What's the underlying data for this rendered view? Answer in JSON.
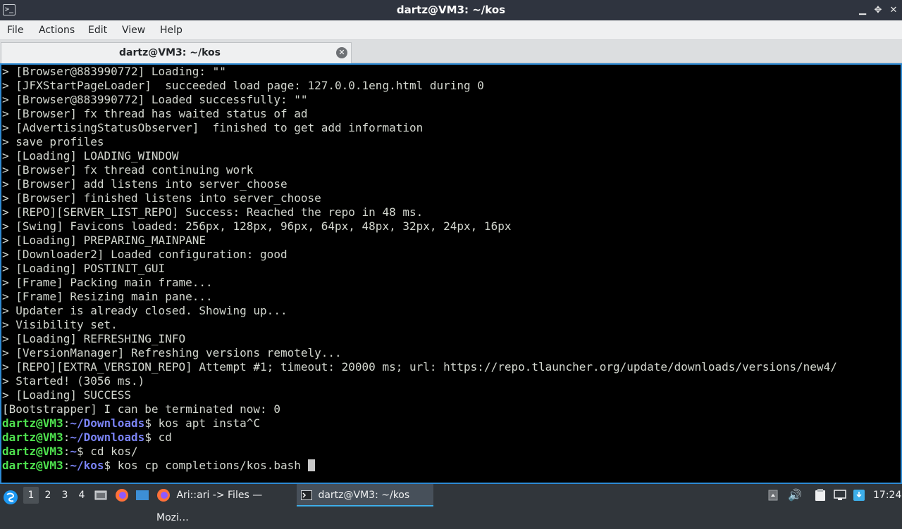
{
  "window": {
    "app_icon": ">_",
    "title": "dartz@VM3: ~/kos",
    "minimize": "▁",
    "maximize": "✥",
    "close": "✕"
  },
  "menu": [
    "File",
    "Actions",
    "Edit",
    "View",
    "Help"
  ],
  "tab": {
    "label": "dartz@VM3: ~/kos",
    "close": "✕"
  },
  "terminal": {
    "lines": [
      "> [Browser@883990772] Loading: \"\"",
      "> [JFXStartPageLoader]  succeeded load page: 127.0.0.1eng.html during 0",
      "> [Browser@883990772] Loaded successfully: \"\"",
      "> [Browser] fx thread has waited status of ad",
      "> [AdvertisingStatusObserver]  finished to get add information",
      "> save profiles",
      "> [Loading] LOADING_WINDOW",
      "> [Browser] fx thread continuing work",
      "> [Browser] add listens into server_choose",
      "> [Browser] finished listens into server_choose",
      "> [REPO][SERVER_LIST_REPO] Success: Reached the repo in 48 ms.",
      "> [Swing] Favicons loaded: 256px, 128px, 96px, 64px, 48px, 32px, 24px, 16px",
      "> [Loading] PREPARING_MAINPANE",
      "> [Downloader2] Loaded configuration: good",
      "> [Loading] POSTINIT_GUI",
      "> [Frame] Packing main frame...",
      "> [Frame] Resizing main pane...",
      "> Updater is already closed. Showing up...",
      "> Visibility set.",
      "> [Loading] REFRESHING_INFO",
      "> [VersionManager] Refreshing versions remotely...",
      "> [REPO][EXTRA_VERSION_REPO] Attempt #1; timeout: 20000 ms; url: https://repo.tlauncher.org/update/downloads/versions/new4/",
      "> Started! (3056 ms.)",
      "> [Loading] SUCCESS",
      "[Bootstrapper] I can be terminated now: 0"
    ],
    "prompts": [
      {
        "user": "dartz@VM3",
        "colon": ":",
        "path": "~/Downloads",
        "cmd": "$ kos apt insta^C"
      },
      {
        "user": "dartz@VM3",
        "colon": ":",
        "path": "~/Downloads",
        "cmd": "$ cd"
      },
      {
        "user": "dartz@VM3",
        "colon": ":",
        "path": "~",
        "cmd": "$ cd kos/"
      },
      {
        "user": "dartz@VM3",
        "colon": ":",
        "path": "~/kos",
        "cmd": "$ kos cp completions/kos.bash "
      }
    ]
  },
  "taskbar": {
    "desktops": [
      "1",
      "2",
      "3",
      "4"
    ],
    "active_desktop": "1",
    "tasks": [
      {
        "label": "Ari::ari -> Files — Mozi…",
        "icon": "firefox-icon"
      },
      {
        "label": "dartz@VM3: ~/kos",
        "icon": "terminal-icon"
      }
    ],
    "clock": "17:24"
  },
  "colors": {
    "prompt_user": "#4ee24e",
    "prompt_path": "#7a83f5",
    "accent": "#2d8ad4"
  }
}
